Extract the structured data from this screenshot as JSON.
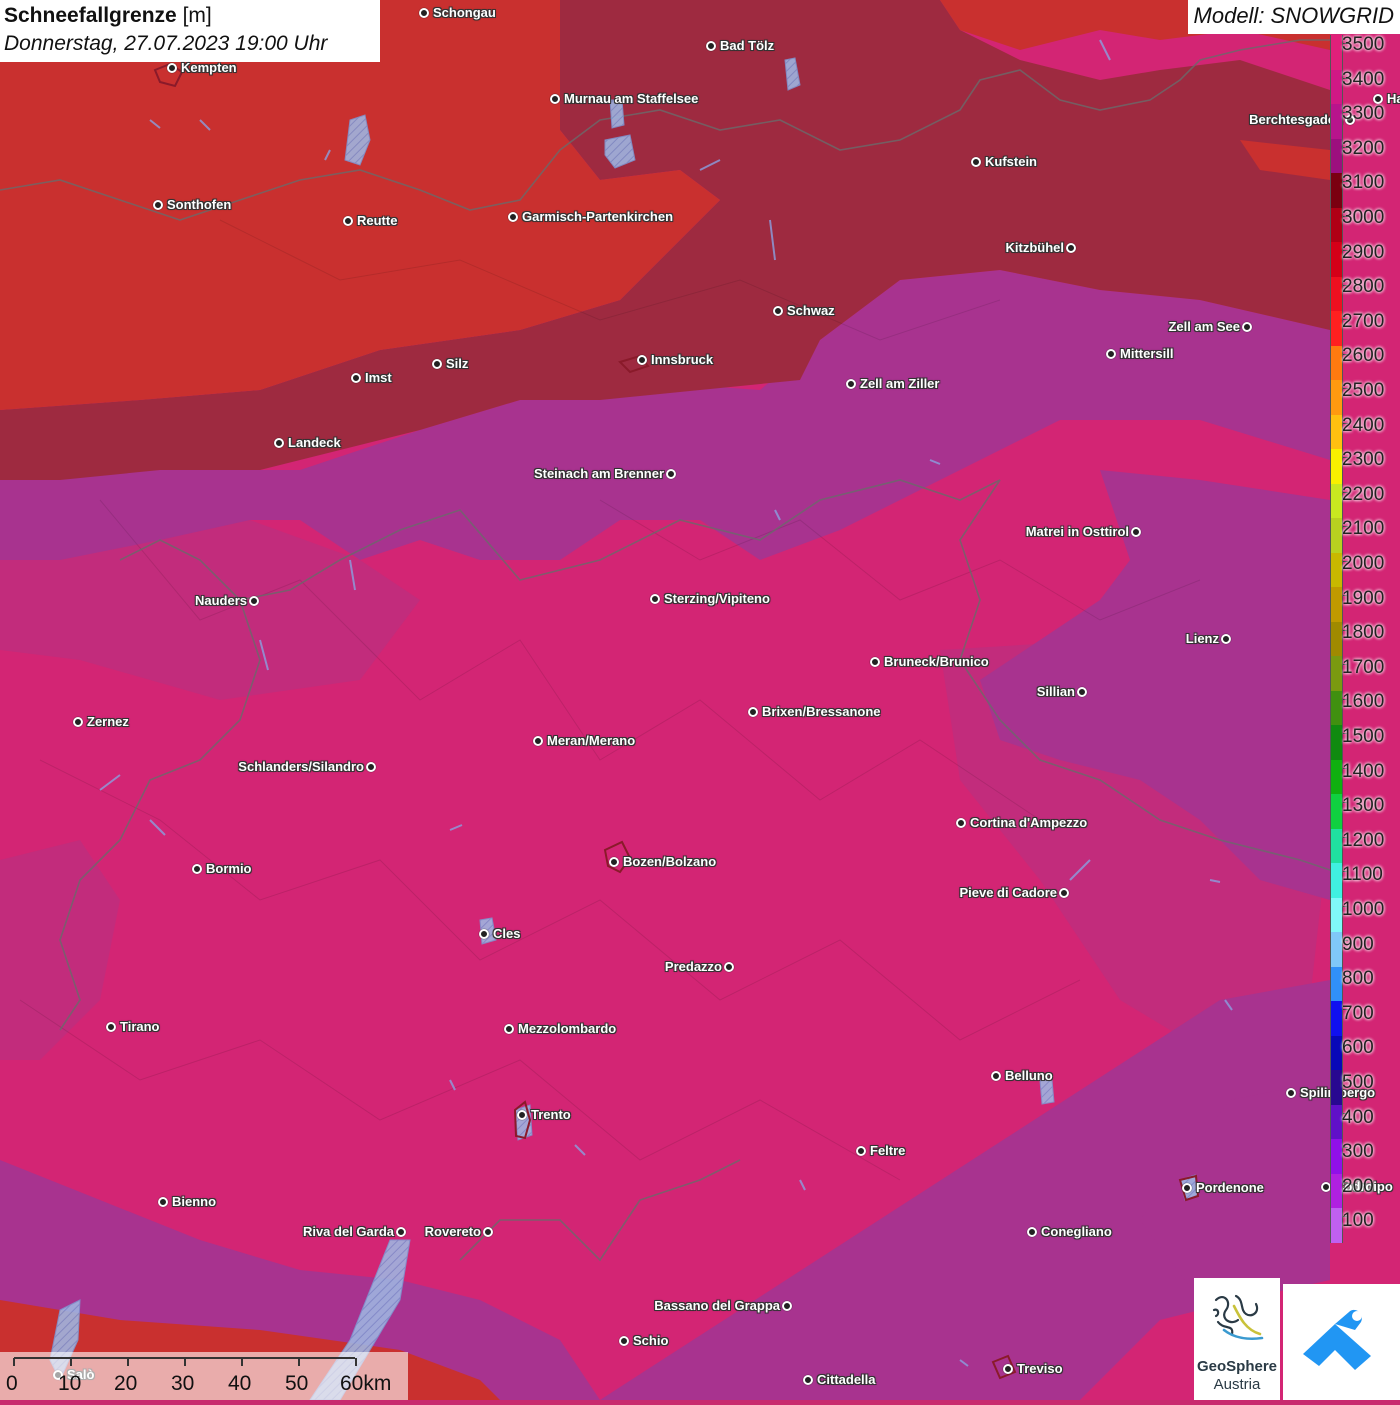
{
  "title": {
    "main": "Schneefallgrenze",
    "unit": "[m]",
    "date": "Donnerstag, 27.07.2023 19:00 Uhr"
  },
  "model": "Modell: SNOWGRID",
  "colors": {
    "zone_3100": "#9e2a40",
    "zone_3000": "#c9302f",
    "zone_3200": "#a8338f",
    "zone_3300": "#c22c7c",
    "zone_3400": "#d32574"
  },
  "legend": {
    "levels": [
      "3500",
      "3400",
      "3300",
      "3200",
      "3100",
      "3000",
      "2900",
      "2800",
      "2700",
      "2600",
      "2500",
      "2400",
      "2300",
      "2200",
      "2100",
      "2000",
      "1900",
      "1800",
      "1700",
      "1600",
      "1500",
      "1400",
      "1300",
      "1200",
      "1100",
      "1000",
      "900",
      "800",
      "700",
      "600",
      "500",
      "400",
      "300",
      "200",
      "100"
    ],
    "colors": [
      "#e0207a",
      "#d01885",
      "#b8148c",
      "#9c0f7e",
      "#7a0010",
      "#b00015",
      "#d40018",
      "#ee1020",
      "#ff2020",
      "#ff7a10",
      "#ff9a10",
      "#ffc010",
      "#f8f000",
      "#c8e820",
      "#b8d020",
      "#c8b800",
      "#c09a00",
      "#a08a00",
      "#7a9a10",
      "#409010",
      "#108a10",
      "#10b010",
      "#10d040",
      "#20e0a0",
      "#40f0e0",
      "#80f8f8",
      "#80c8f8",
      "#3090f8",
      "#1010f0",
      "#0808b8",
      "#280890",
      "#6010c8",
      "#9010e8",
      "#b020e0",
      "#c060f0"
    ]
  },
  "cities": [
    {
      "name": "Schongau",
      "side": "right"
    },
    {
      "name": "Bad Tölz",
      "side": "right"
    },
    {
      "name": "Kempten",
      "side": "right"
    },
    {
      "name": "Murnau am Staffelsee",
      "side": "right"
    },
    {
      "name": "Hallein",
      "side": "right"
    },
    {
      "name": "Berchtesgaden",
      "side": "left"
    },
    {
      "name": "Kufstein",
      "side": "right"
    },
    {
      "name": "Sonthofen",
      "side": "right"
    },
    {
      "name": "Reutte",
      "side": "right"
    },
    {
      "name": "Garmisch-Partenkirchen",
      "side": "right"
    },
    {
      "name": "Kitzbühel",
      "side": "left"
    },
    {
      "name": "Schwaz",
      "side": "right"
    },
    {
      "name": "Zell am See",
      "side": "left"
    },
    {
      "name": "Innsbruck",
      "side": "right"
    },
    {
      "name": "Mittersill",
      "side": "right"
    },
    {
      "name": "Imst",
      "side": "right"
    },
    {
      "name": "Silz",
      "side": "right"
    },
    {
      "name": "Zell am Ziller",
      "side": "right"
    },
    {
      "name": "Landeck",
      "side": "right"
    },
    {
      "name": "Steinach am Brenner",
      "side": "left"
    },
    {
      "name": "Matrei in Osttirol",
      "side": "left"
    },
    {
      "name": "Nauders",
      "side": "left"
    },
    {
      "name": "Sterzing/Vipiteno",
      "side": "right"
    },
    {
      "name": "Lienz",
      "side": "left"
    },
    {
      "name": "Bruneck/Brunico",
      "side": "right"
    },
    {
      "name": "Sillian",
      "side": "left"
    },
    {
      "name": "Brixen/Bressanone",
      "side": "right"
    },
    {
      "name": "Zernez",
      "side": "right"
    },
    {
      "name": "Meran/Merano",
      "side": "right"
    },
    {
      "name": "Schlanders/Silandro",
      "side": "left"
    },
    {
      "name": "Cortina d'Ampezzo",
      "side": "right"
    },
    {
      "name": "Bozen/Bolzano",
      "side": "right"
    },
    {
      "name": "Bormio",
      "side": "right"
    },
    {
      "name": "Pieve di Cadore",
      "side": "left"
    },
    {
      "name": "Cles",
      "side": "right"
    },
    {
      "name": "Predazzo",
      "side": "left"
    },
    {
      "name": "Tirano",
      "side": "right"
    },
    {
      "name": "Mezzolombardo",
      "side": "right"
    },
    {
      "name": "Belluno",
      "side": "right"
    },
    {
      "name": "Spilimbergo",
      "side": "right"
    },
    {
      "name": "Trento",
      "side": "right"
    },
    {
      "name": "Feltre",
      "side": "right"
    },
    {
      "name": "Pordenone",
      "side": "right"
    },
    {
      "name": "Codroipo",
      "side": "right"
    },
    {
      "name": "Bienno",
      "side": "right"
    },
    {
      "name": "Riva del Garda",
      "side": "left"
    },
    {
      "name": "Rovereto",
      "side": "left"
    },
    {
      "name": "Conegliano",
      "side": "right"
    },
    {
      "name": "Bassano del Grappa",
      "side": "left"
    },
    {
      "name": "Schio",
      "side": "right"
    },
    {
      "name": "Salò",
      "side": "right"
    },
    {
      "name": "Treviso",
      "side": "right"
    },
    {
      "name": "Cittadella",
      "side": "right"
    }
  ],
  "scalebar": {
    "labels": [
      "0",
      "10",
      "20",
      "30",
      "40",
      "50",
      "60km"
    ]
  },
  "logos": {
    "geosphere_line1": "GeoSphere",
    "geosphere_line2": "Austria"
  }
}
